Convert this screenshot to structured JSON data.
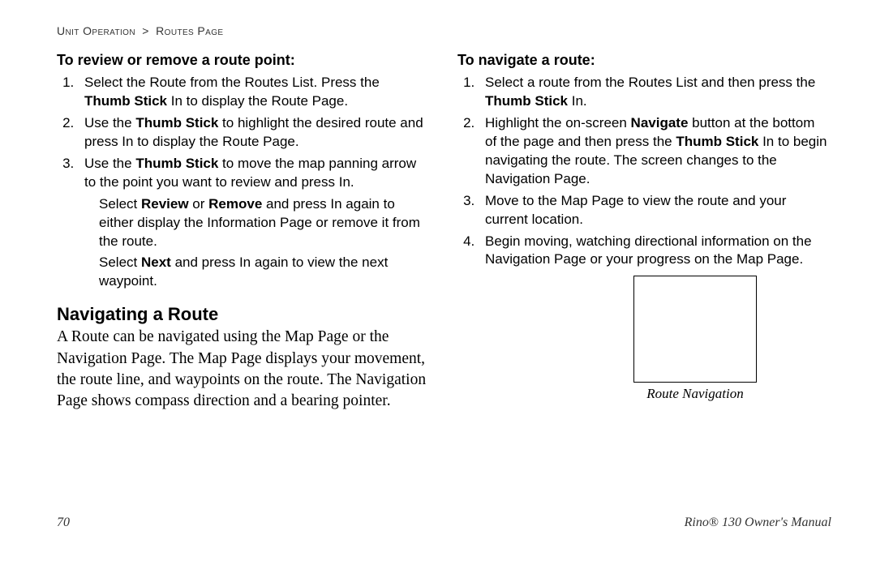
{
  "breadcrumb": {
    "a": "Unit Operation",
    "sep": ">",
    "b": "Routes Page"
  },
  "left": {
    "subhead": "To review or remove a route point:",
    "steps": {
      "s1a": "Select the Route from the Routes List. Press the ",
      "s1b": "Thumb Stick",
      "s1c": " In to display the Route Page.",
      "s2a": "Use the ",
      "s2b": "Thumb Stick",
      "s2c": " to highlight the desired route and press In to display the Route Page.",
      "s3a": "Use the ",
      "s3b": "Thumb Stick",
      "s3c": " to move the map panning arrow to the point you want to review and press In."
    },
    "p1a": "Select ",
    "p1b": "Review",
    "p1c": " or ",
    "p1d": "Remove",
    "p1e": " and press In again to either display the Information Page or remove it from the route.",
    "p2a": "Select ",
    "p2b": "Next",
    "p2c": " and press In again to view the next waypoint.",
    "h2": "Navigating a Route",
    "para": "A Route can be navigated using the Map Page or the Navigation Page. The Map Page displays your movement, the route line, and waypoints on the route. The Navigation Page shows compass direction and a bearing pointer."
  },
  "right": {
    "subhead": "To navigate a route:",
    "steps": {
      "s1a": "Select a route from the Routes List and then press the ",
      "s1b": "Thumb Stick",
      "s1c": " In.",
      "s2a": "Highlight the on-screen ",
      "s2b": "Navigate",
      "s2c": " button at the bottom of the page and then press the ",
      "s2d": "Thumb Stick",
      "s2e": " In to begin navigating the route. The screen changes to the Navigation Page.",
      "s3": "Move to the Map Page to view the route and your current location.",
      "s4": "Begin moving, watching directional information on the Navigation Page or your progress on the Map Page."
    },
    "caption": "Route Navigation"
  },
  "footer": {
    "page": "70",
    "manual_a": "Rino",
    "manual_b": "®",
    "manual_c": " 130 Owner's Manual"
  }
}
